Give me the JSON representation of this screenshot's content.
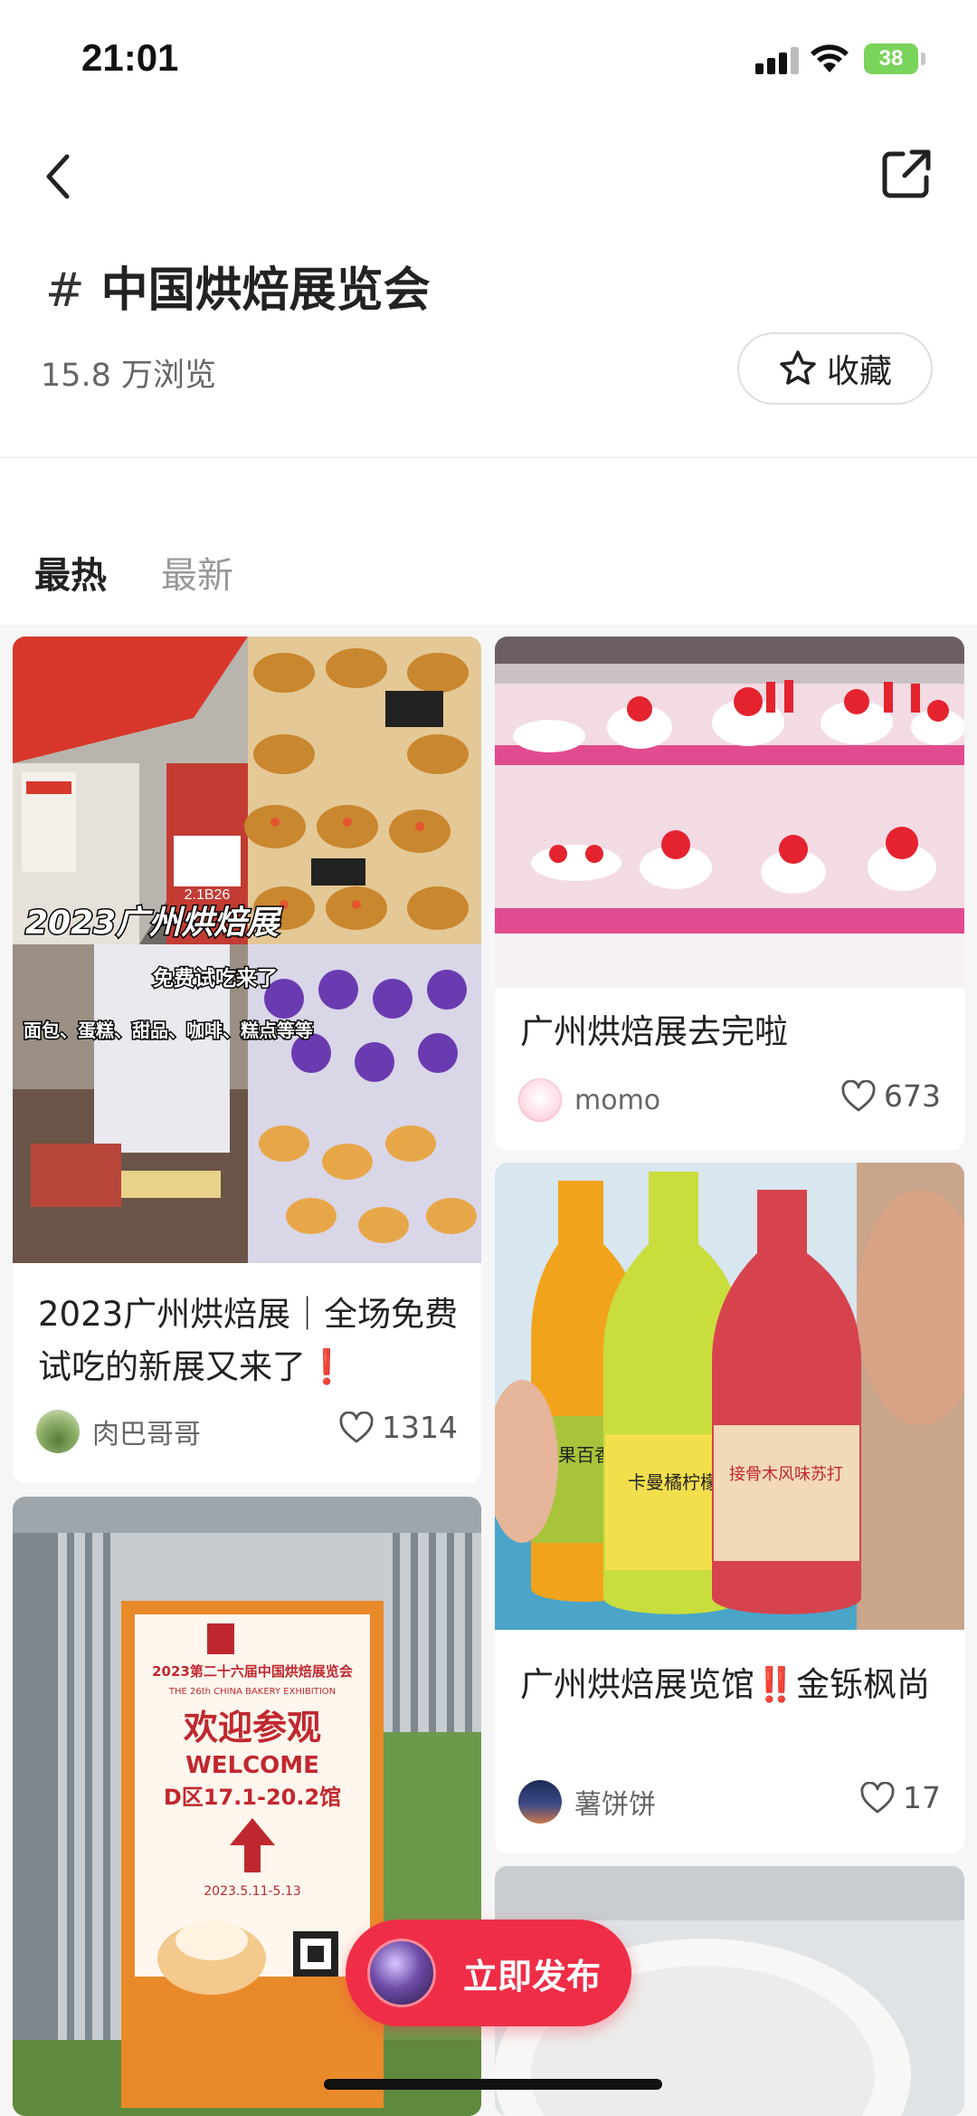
{
  "status_bar": {
    "time": "21:01",
    "battery": "38"
  },
  "header": {
    "hash": "#",
    "title": "中国烘焙展览会",
    "views": "15.8 万浏览",
    "favorite_label": "收藏"
  },
  "tabs": [
    {
      "label": "最热",
      "active": true
    },
    {
      "label": "最新",
      "active": false
    }
  ],
  "posts": [
    {
      "title": "2023广州烘焙展｜全场免费试吃的新展又来了",
      "title_suffix": "❗",
      "author": "肉巴哥哥",
      "likes": "1314",
      "image_text": {
        "headline": "2023广州烘焙展",
        "sub": "免费试吃来了",
        "caption": "面包、蛋糕、甜品、咖啡、糕点等等",
        "sign": "2.1B26"
      }
    },
    {
      "title": "广州烘焙展去完啦",
      "author": "momo",
      "likes": "673"
    },
    {
      "title_prefix": "广州烘焙展览馆",
      "title_marks": "‼️",
      "title_rest": "金铄枫尚",
      "author": "薯饼饼",
      "likes": "17",
      "image_text": {
        "label1": "芒果百香果",
        "label2": "卡曼橘柠檬",
        "label3": "接骨木风味苏打"
      }
    },
    {
      "image_text": {
        "line1": "2023第二十六届中国烘焙展览会",
        "line2": "THE 26th CHINA BAKERY EXHIBITION",
        "line3": "欢迎参观",
        "line4": "WELCOME",
        "line5": "D区17.1-20.2馆",
        "line6": "2023.5.11-5.13"
      }
    }
  ],
  "publish_button": {
    "label": "立即发布"
  },
  "colors": {
    "accent": "#f02d47",
    "background": "#f6f6f6"
  }
}
